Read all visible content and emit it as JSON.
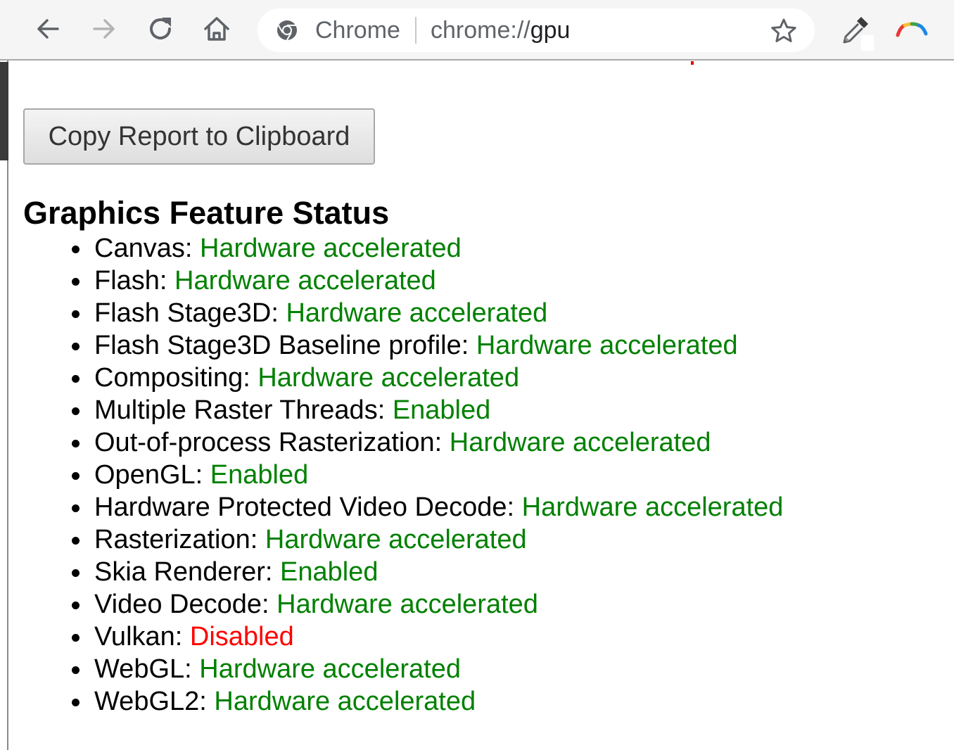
{
  "toolbar": {
    "site_label": "Chrome",
    "url_scheme": "chrome://",
    "url_host": "gpu"
  },
  "page": {
    "copy_button_label": "Copy Report to Clipboard",
    "section_title": "Graphics Feature Status",
    "features": [
      {
        "name": "Canvas: ",
        "status": "Hardware accelerated",
        "color": "#008000"
      },
      {
        "name": "Flash: ",
        "status": "Hardware accelerated",
        "color": "#008000"
      },
      {
        "name": "Flash Stage3D: ",
        "status": "Hardware accelerated",
        "color": "#008000"
      },
      {
        "name": "Flash Stage3D Baseline profile: ",
        "status": "Hardware accelerated",
        "color": "#008000"
      },
      {
        "name": "Compositing: ",
        "status": "Hardware accelerated",
        "color": "#008000"
      },
      {
        "name": "Multiple Raster Threads: ",
        "status": "Enabled",
        "color": "#008000"
      },
      {
        "name": "Out-of-process Rasterization: ",
        "status": "Hardware accelerated",
        "color": "#008000"
      },
      {
        "name": "OpenGL: ",
        "status": "Enabled",
        "color": "#008000"
      },
      {
        "name": "Hardware Protected Video Decode: ",
        "status": "Hardware accelerated",
        "color": "#008000"
      },
      {
        "name": "Rasterization: ",
        "status": "Hardware accelerated",
        "color": "#008000"
      },
      {
        "name": "Skia Renderer: ",
        "status": "Enabled",
        "color": "#008000"
      },
      {
        "name": "Video Decode: ",
        "status": "Hardware accelerated",
        "color": "#008000"
      },
      {
        "name": "Vulkan: ",
        "status": "Disabled",
        "color": "#ff0000"
      },
      {
        "name": "WebGL: ",
        "status": "Hardware accelerated",
        "color": "#008000"
      },
      {
        "name": "WebGL2: ",
        "status": "Hardware accelerated",
        "color": "#008000"
      }
    ]
  },
  "icons": {
    "back": "back-arrow-icon",
    "forward": "forward-arrow-icon",
    "reload": "reload-icon",
    "home": "home-icon",
    "site": "chrome-logo-icon",
    "bookmark": "star-icon",
    "extension_1": "eyedropper-icon",
    "extension_2": "rainbow-logo-icon"
  }
}
